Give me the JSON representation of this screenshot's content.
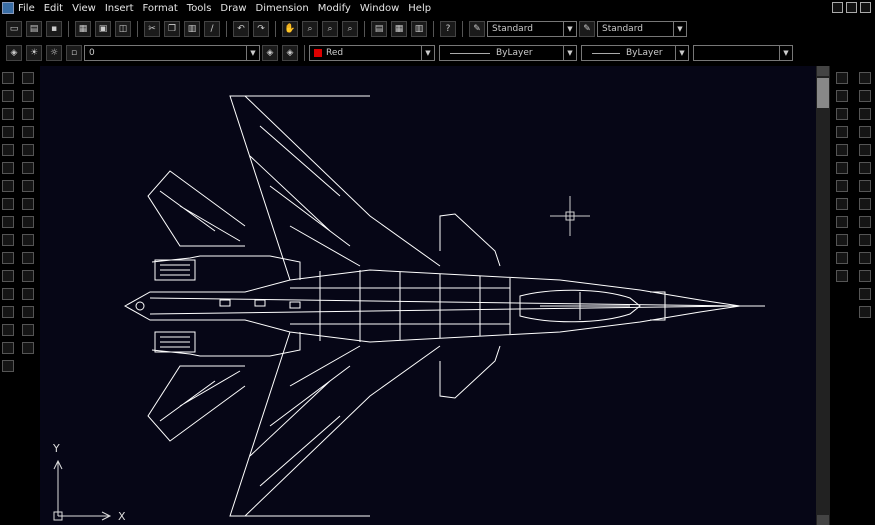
{
  "menu": {
    "items": [
      "File",
      "Edit",
      "View",
      "Insert",
      "Format",
      "Tools",
      "Draw",
      "Dimension",
      "Modify",
      "Window",
      "Help"
    ]
  },
  "toolbar": {
    "text_style": "Standard",
    "dim_style": "Standard",
    "layer": "0",
    "color": "Red",
    "linetype": "ByLayer",
    "lineweight": "ByLayer"
  },
  "ucs": {
    "x_label": "X",
    "y_label": "Y"
  },
  "colors": {
    "canvas": "#060616",
    "drawing": "#ffffff",
    "layer_color_swatch": "#dd0000"
  },
  "icons": {
    "standard_toolbar": [
      "new-icon",
      "open-icon",
      "save-icon",
      "print-icon",
      "preview-icon",
      "plot-icon",
      "cut-icon",
      "copy-icon",
      "paste-icon",
      "match-icon",
      "undo-icon",
      "redo-icon",
      "pan-icon",
      "zoom-icon",
      "zoom-window-icon",
      "zoom-previous-icon",
      "properties-icon",
      "designcenter-icon",
      "tool-palettes-icon",
      "help-icon"
    ],
    "draw_toolbar": [
      "line-icon",
      "construction-line-icon",
      "polyline-icon",
      "polygon-icon",
      "rectangle-icon",
      "arc-icon",
      "circle-icon",
      "revcloud-icon",
      "spline-icon",
      "ellipse-icon",
      "insert-block-icon",
      "make-block-icon",
      "point-icon",
      "hatch-icon",
      "region-icon",
      "table-icon",
      "mtext-icon"
    ],
    "modify_toolbar": [
      "erase-icon",
      "copy-object-icon",
      "mirror-icon",
      "offset-icon",
      "array-icon",
      "move-icon",
      "rotate-icon",
      "scale-icon",
      "stretch-icon",
      "trim-icon",
      "extend-icon",
      "break-icon",
      "join-icon",
      "chamfer-icon",
      "fillet-icon",
      "explode-icon"
    ]
  }
}
